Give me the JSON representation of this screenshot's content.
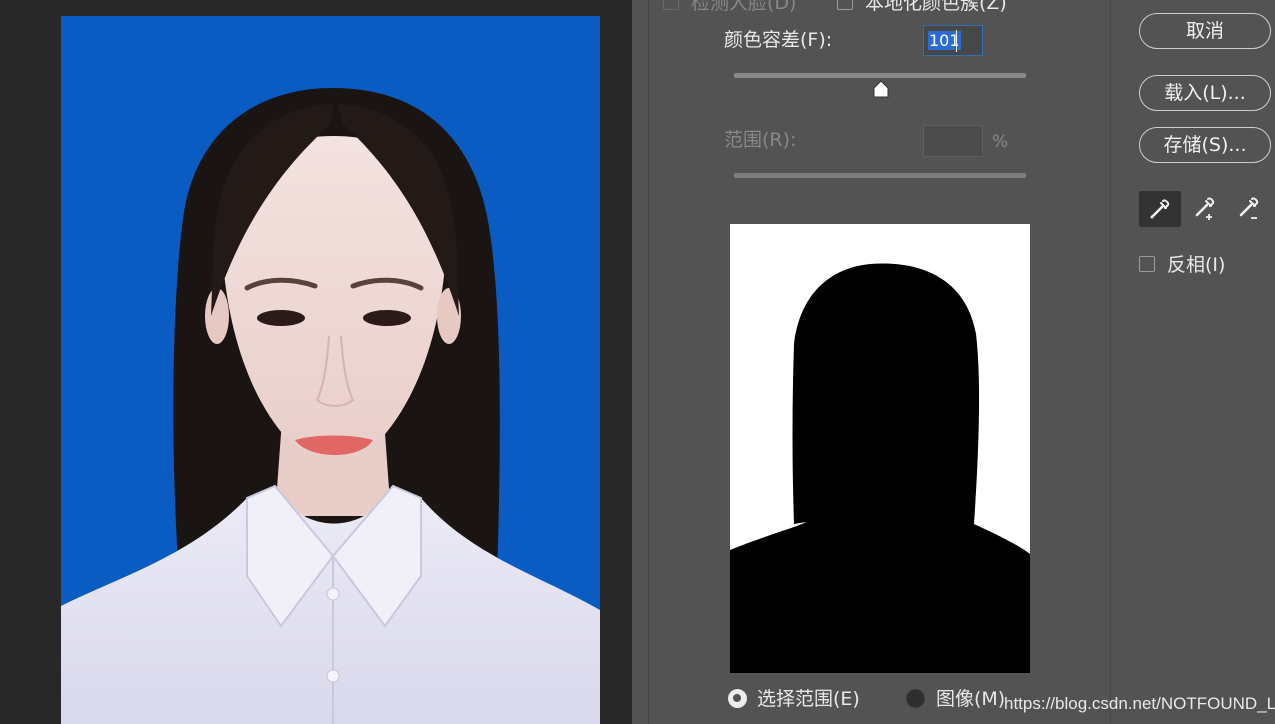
{
  "dialog": {
    "detect_faces_label": "检测人脸(D)",
    "localized_clusters_label": "本地化颜色簇(Z)",
    "fuzziness_label": "颜色容差(F):",
    "fuzziness_value": "101",
    "range_label": "范围(R):",
    "range_unit": "%",
    "selection_option_label": "选择范围(E)",
    "image_option_label": "图像(M)",
    "selected_view": "selection"
  },
  "buttons": {
    "cancel": "取消",
    "load": "载入(L)...",
    "save": "存储(S)..."
  },
  "eyedroppers": [
    "eyedropper-icon",
    "eyedropper-add-icon",
    "eyedropper-subtract-icon"
  ],
  "invert_label": "反相(I)",
  "watermark": "https://blog.csdn.net/NOTFOUND_Liu",
  "colors": {
    "dialog_bg": "#535353",
    "canvas_bg": "#282828",
    "photo_background": "#0a5cc2",
    "selection_highlight": "#2b6cd4"
  }
}
